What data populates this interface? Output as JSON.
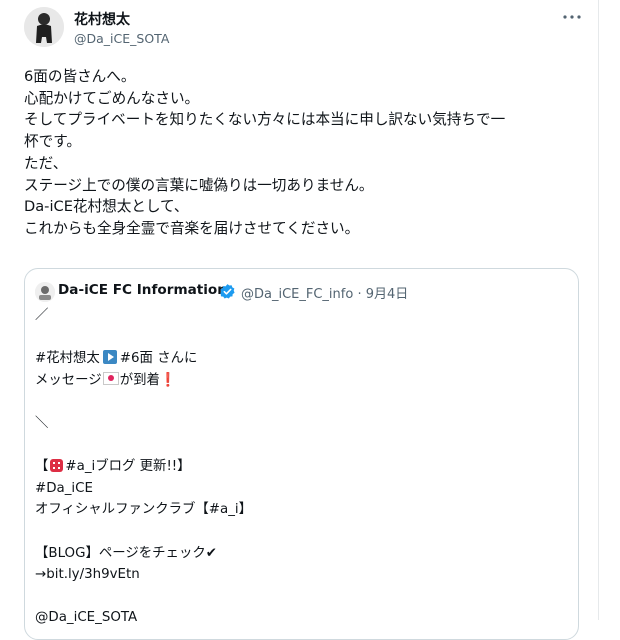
{
  "tweet": {
    "display_name": "花村想太",
    "handle": "@Da_iCE_SOTA",
    "more_icon": "more-icon",
    "lines": [
      "6面の皆さんへ。",
      "心配かけてごめんなさい。",
      "そしてプライベートを知りたくない方々には本当に申し訳ない気持ちで一",
      "杯です。",
      "ただ、",
      "ステージ上での僕の言葉に嘘偽りは一切ありません。",
      "Da-iCE花村想太として、",
      "これからも全身全霊で音楽を届けさせてください。"
    ]
  },
  "quote": {
    "display_name": "Da-iCE FC Information",
    "verified_icon": "verified-badge-icon",
    "handle_date": "@Da_iCE_FC_info · 9月4日",
    "line_slash_open": "／",
    "line_hashtag_1": "#花村想太",
    "line_hashtag_2": "#6面",
    "line_san_ni": " さんに",
    "line_message_a": "メッセージ",
    "line_message_b": "が到着",
    "line_exclaim": "❗",
    "line_slash_close": "＼",
    "line_blog_a": "【",
    "line_blog_tag": "#a_iブログ",
    "line_blog_b": " 更新!!】",
    "line_tag_daice": "#Da_iCE",
    "line_official": "オフィシャルファンクラブ【#a_i】",
    "line_blog_page": "【BLOG】ページをチェック",
    "line_check": "✔",
    "line_link": "→bit.ly/3h9vEtn",
    "line_mention": "@Da_iCE_SOTA"
  },
  "colors": {
    "text": "#0f1419",
    "secondary": "#536471",
    "verified": "#1d9bf0",
    "border": "#cfd9de"
  }
}
